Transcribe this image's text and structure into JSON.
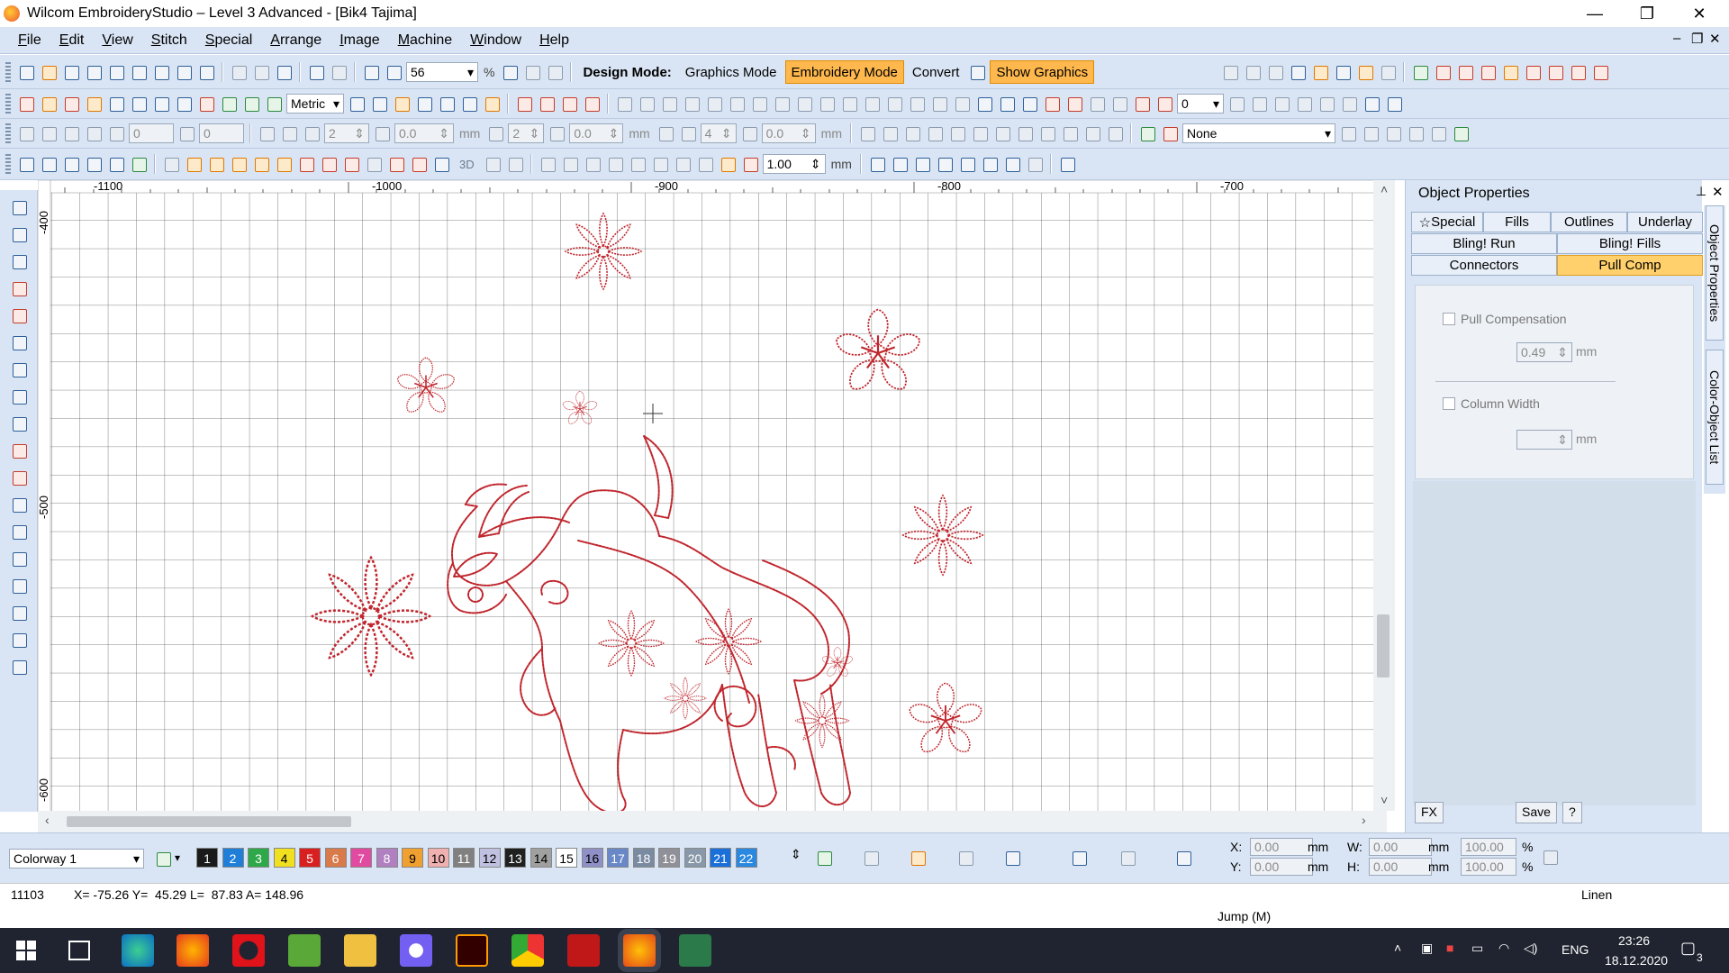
{
  "window": {
    "title": "Wilcom EmbroideryStudio – Level 3 Advanced - [Bik4          Tajima]",
    "controls": [
      "—",
      "❐",
      "✕"
    ]
  },
  "menu": {
    "items": [
      "File",
      "Edit",
      "View",
      "Stitch",
      "Special",
      "Arrange",
      "Image",
      "Machine",
      "Window",
      "Help"
    ],
    "mdi_controls": [
      "–",
      "❐",
      "✕"
    ]
  },
  "toolbar": {
    "zoom_value": "56",
    "zoom_unit": "%",
    "design_mode_label": "Design Mode:",
    "graphics_mode": "Graphics Mode",
    "embroidery_mode": "Embroidery Mode",
    "convert": "Convert",
    "show_graphics": "Show Graphics",
    "units_select": "Metric",
    "row3": {
      "field1": "0",
      "field2": "0",
      "field3": "2",
      "field4": "0.0",
      "unit_mm": "mm",
      "field5": "2",
      "field6": "0.0",
      "unit_mm2": "mm",
      "field7": "4",
      "field8": "0.0",
      "unit_mm3": "mm"
    },
    "row2_right_field": "0",
    "none_select": "None",
    "scale_value": "1.00",
    "scale_unit": "mm",
    "label_3d": "3D"
  },
  "ruler": {
    "x_labels": [
      "-1100",
      "-1000",
      "-900",
      "-800",
      "-700"
    ],
    "y_labels": [
      "-400",
      "-500",
      "-600"
    ]
  },
  "panel": {
    "title": "Object Properties",
    "tabs_row1": [
      "Special",
      "Fills",
      "Outlines",
      "Underlay"
    ],
    "tabs_row2": [
      "Bling! Run",
      "Bling! Fills"
    ],
    "tabs_row3": [
      "Connectors",
      "Pull Comp"
    ],
    "pull_compensation_label": "Pull Compensation",
    "pull_compensation_value": "0.49",
    "pull_unit": "mm",
    "column_width_label": "Column Width",
    "column_width_unit": "mm",
    "footer": {
      "fx": "FX",
      "save": "Save",
      "help": "?"
    },
    "side_tabs": [
      "Object Properties",
      "Color-Object List"
    ]
  },
  "colorway": {
    "select": "Colorway 1",
    "swatches": [
      {
        "n": "1",
        "bg": "#1a1a1a",
        "fg": "#ffffff"
      },
      {
        "n": "2",
        "bg": "#1f7fd8",
        "fg": "#ffffff"
      },
      {
        "n": "3",
        "bg": "#2fa84a",
        "fg": "#ffffff"
      },
      {
        "n": "4",
        "bg": "#f0e020",
        "fg": "#000000"
      },
      {
        "n": "5",
        "bg": "#d82020",
        "fg": "#ffffff"
      },
      {
        "n": "6",
        "bg": "#d87a4a",
        "fg": "#ffffff"
      },
      {
        "n": "7",
        "bg": "#e04aa0",
        "fg": "#ffffff"
      },
      {
        "n": "8",
        "bg": "#b080c0",
        "fg": "#ffffff"
      },
      {
        "n": "9",
        "bg": "#f0a030",
        "fg": "#000000"
      },
      {
        "n": "10",
        "bg": "#f0b0b0",
        "fg": "#000000"
      },
      {
        "n": "11",
        "bg": "#808080",
        "fg": "#ffffff"
      },
      {
        "n": "12",
        "bg": "#c0c0e0",
        "fg": "#000000"
      },
      {
        "n": "13",
        "bg": "#202020",
        "fg": "#ffffff"
      },
      {
        "n": "14",
        "bg": "#a0a0a0",
        "fg": "#000000"
      },
      {
        "n": "15",
        "bg": "#ffffff",
        "fg": "#000000"
      },
      {
        "n": "16",
        "bg": "#9090c8",
        "fg": "#000000"
      },
      {
        "n": "17",
        "bg": "#6888c8",
        "fg": "#ffffff"
      },
      {
        "n": "18",
        "bg": "#7a8aa0",
        "fg": "#ffffff"
      },
      {
        "n": "19",
        "bg": "#909098",
        "fg": "#ffffff"
      },
      {
        "n": "20",
        "bg": "#8898a8",
        "fg": "#ffffff"
      },
      {
        "n": "21",
        "bg": "#1a70d8",
        "fg": "#ffffff"
      },
      {
        "n": "22",
        "bg": "#2a88e0",
        "fg": "#ffffff"
      }
    ],
    "xy": {
      "x_label": "X:",
      "x_value": "0.00",
      "y_label": "Y:",
      "y_value": "0.00",
      "w_label": "W:",
      "w_value": "0.00",
      "h_label": "H:",
      "h_value": "0.00",
      "unit": "mm",
      "w_pct": "100.00",
      "h_pct": "100.00",
      "pct": "%"
    }
  },
  "status": {
    "stitch_count": "11103",
    "coords": "X= -75.26 Y=  45.29 L=  87.83 A= 148.96",
    "jump": "Jump (M)",
    "fabric": "Linen"
  },
  "taskbar": {
    "language": "ENG",
    "time": "23:26",
    "date": "18.12.2020",
    "notifications": "3"
  },
  "colors": {
    "accent_orange": "#ffb84d",
    "stitch_red": "#c0262d",
    "chrome_blue": "#d9e5f4"
  }
}
